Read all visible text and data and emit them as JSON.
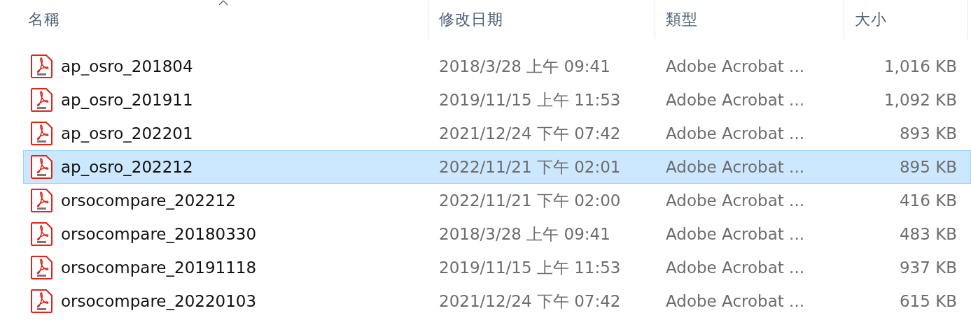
{
  "columns": [
    {
      "label": "名稱",
      "sorted": true
    },
    {
      "label": "修改日期",
      "sorted": false
    },
    {
      "label": "類型",
      "sorted": false
    },
    {
      "label": "大小",
      "sorted": false
    }
  ],
  "rows": [
    {
      "name": "ap_osro_201804",
      "modified": "2018/3/28 上午 09:41",
      "type": "Adobe Acrobat ...",
      "size": "1,016 KB",
      "selected": false
    },
    {
      "name": "ap_osro_201911",
      "modified": "2019/11/15 上午 11:53",
      "type": "Adobe Acrobat ...",
      "size": "1,092 KB",
      "selected": false
    },
    {
      "name": "ap_osro_202201",
      "modified": "2021/12/24 下午 07:42",
      "type": "Adobe Acrobat ...",
      "size": "893 KB",
      "selected": false
    },
    {
      "name": "ap_osro_202212",
      "modified": "2022/11/21 下午 02:01",
      "type": "Adobe Acrobat ...",
      "size": "895 KB",
      "selected": true
    },
    {
      "name": "orsocompare_202212",
      "modified": "2022/11/21 下午 02:00",
      "type": "Adobe Acrobat ...",
      "size": "416 KB",
      "selected": false
    },
    {
      "name": "orsocompare_20180330",
      "modified": "2018/3/28 上午 09:41",
      "type": "Adobe Acrobat ...",
      "size": "483 KB",
      "selected": false
    },
    {
      "name": "orsocompare_20191118",
      "modified": "2019/11/15 上午 11:53",
      "type": "Adobe Acrobat ...",
      "size": "937 KB",
      "selected": false
    },
    {
      "name": "orsocompare_20220103",
      "modified": "2021/12/24 下午 07:42",
      "type": "Adobe Acrobat ...",
      "size": "615 KB",
      "selected": false
    }
  ]
}
